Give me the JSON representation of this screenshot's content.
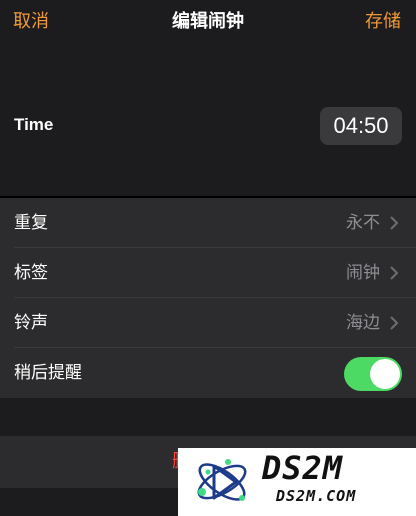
{
  "navbar": {
    "cancel_label": "取消",
    "title": "编辑闹钟",
    "save_label": "存储"
  },
  "time": {
    "label": "Time",
    "value": "04:50"
  },
  "settings": {
    "repeat": {
      "label": "重复",
      "value": "永不"
    },
    "label_row": {
      "label": "标签",
      "value": "闹钟"
    },
    "sound": {
      "label": "铃声",
      "value": "海边"
    },
    "snooze": {
      "label": "稍后提醒",
      "enabled": true
    }
  },
  "delete": {
    "label": "删除闹钟"
  },
  "watermark": {
    "brand": "DS2M",
    "domain": "DS2M.COM"
  },
  "colors": {
    "accent": "#f09a37",
    "toggle_on": "#4cd964",
    "destructive": "#ff453a",
    "secondary_text": "#8e8e93"
  }
}
